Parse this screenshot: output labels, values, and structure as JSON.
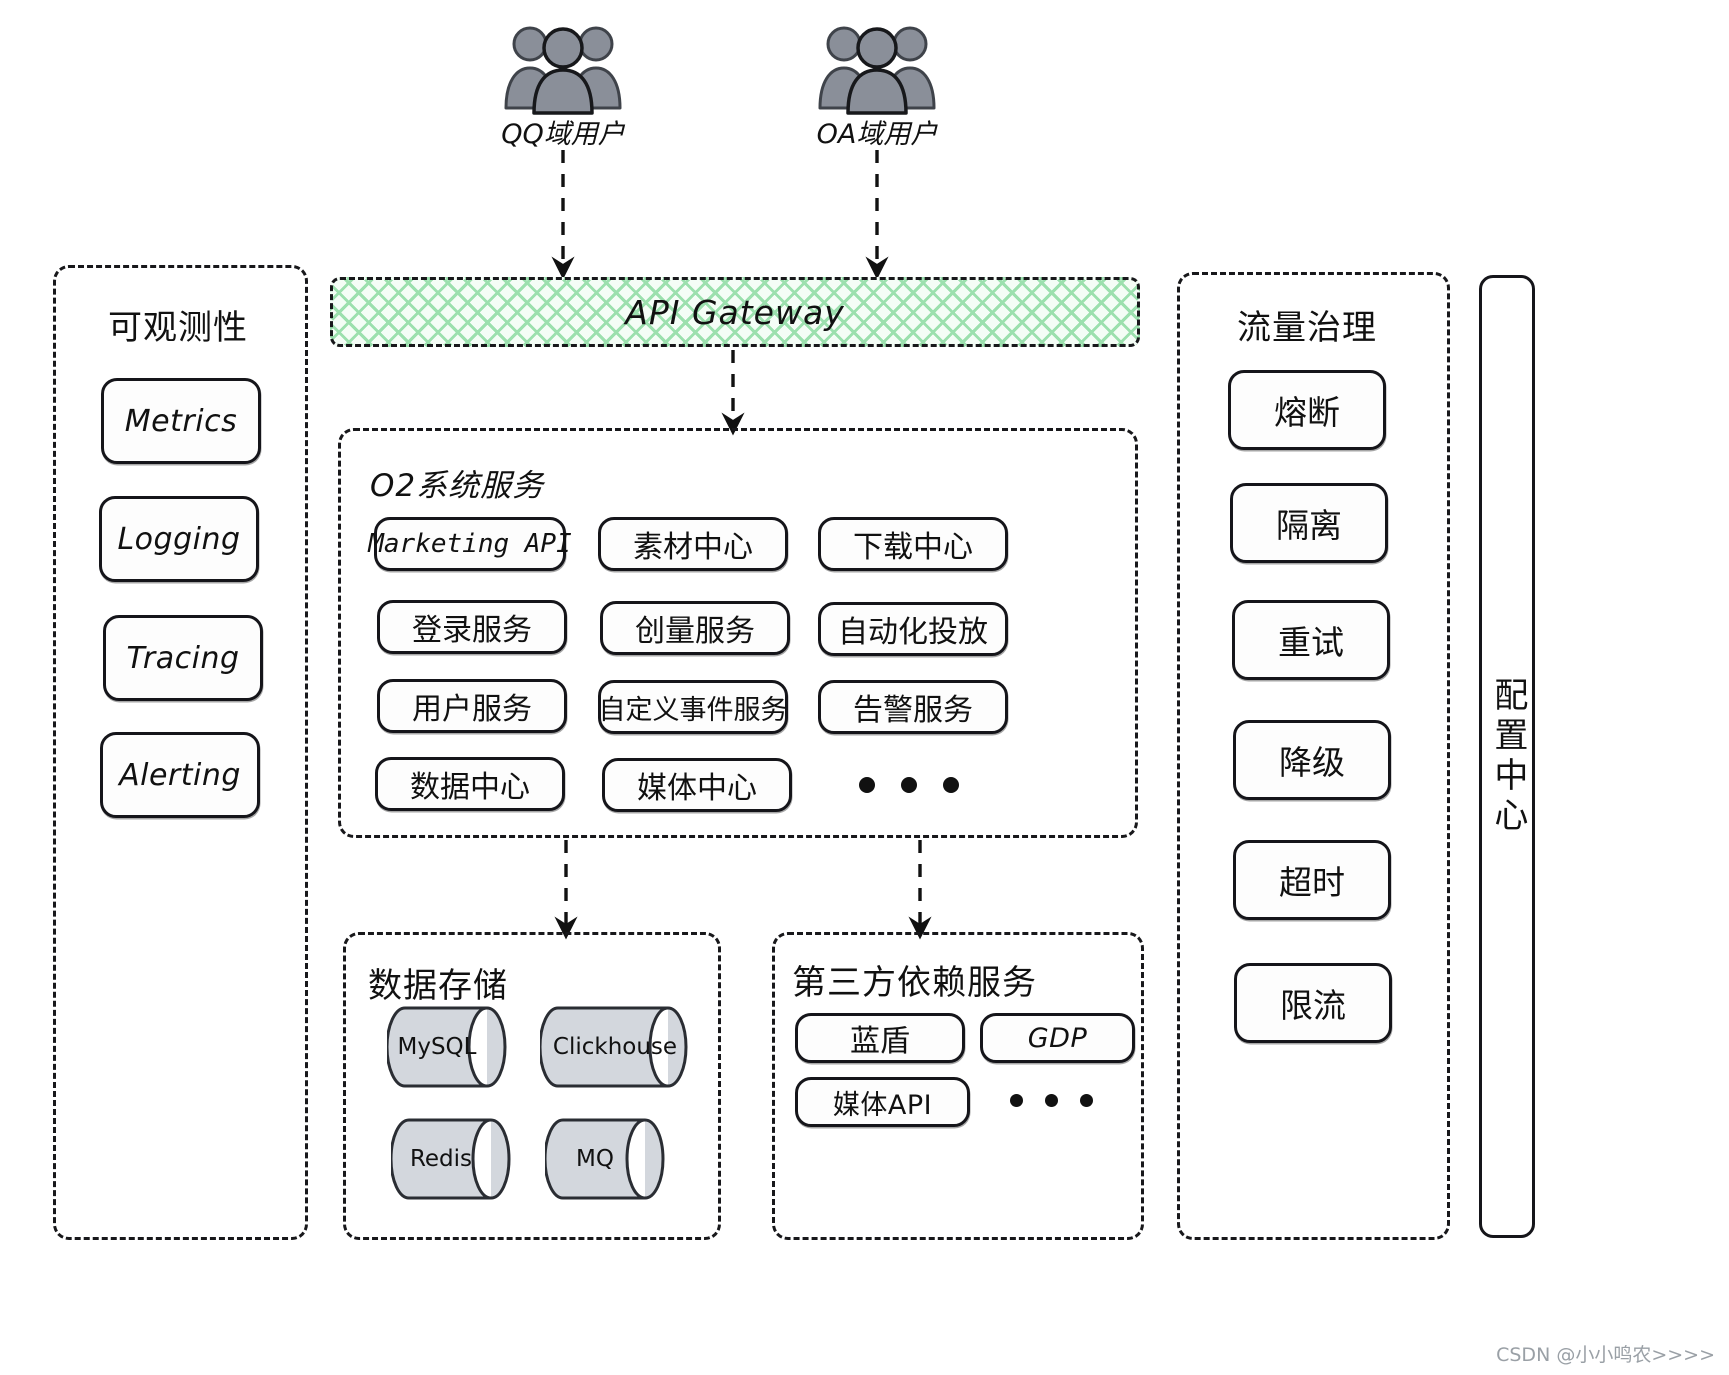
{
  "actors": [
    {
      "id": "qq",
      "label": "QQ域用户",
      "icon": "users-group-icon"
    },
    {
      "id": "oa",
      "label": "OA域用户",
      "icon": "users-group-icon"
    }
  ],
  "api_gateway": {
    "label": "API Gateway",
    "fill_color": "#9ce0ae",
    "border_color": "#18181b"
  },
  "observability": {
    "title": "可观测性",
    "items": [
      {
        "label": "Metrics"
      },
      {
        "label": "Logging"
      },
      {
        "label": "Tracing"
      },
      {
        "label": "Alerting"
      }
    ]
  },
  "o2_services": {
    "title": "O2系统服务",
    "rows": [
      [
        {
          "label": "Marketing API",
          "style": "mono"
        },
        {
          "label": "素材中心"
        },
        {
          "label": "下载中心"
        }
      ],
      [
        {
          "label": "登录服务"
        },
        {
          "label": "创量服务"
        },
        {
          "label": "自动化投放"
        }
      ],
      [
        {
          "label": "用户服务"
        },
        {
          "label": "自定义事件服务"
        },
        {
          "label": "告警服务"
        }
      ],
      [
        {
          "label": "数据中心"
        },
        {
          "label": "媒体中心"
        },
        {
          "label": "···",
          "type": "ellipsis"
        }
      ]
    ]
  },
  "data_storage": {
    "title": "数据存储",
    "items": [
      {
        "label": "MySQL"
      },
      {
        "label": "Clickhouse"
      },
      {
        "label": "Redis"
      },
      {
        "label": "MQ"
      }
    ]
  },
  "third_party": {
    "title": "第三方依赖服务",
    "items": [
      {
        "label": "蓝盾"
      },
      {
        "label": "GDP",
        "style": "en"
      },
      {
        "label": "媒体API",
        "style": "en"
      },
      {
        "label": "···",
        "type": "ellipsis"
      }
    ]
  },
  "traffic_governance": {
    "title": "流量治理",
    "items": [
      {
        "label": "熔断"
      },
      {
        "label": "隔离"
      },
      {
        "label": "重试"
      },
      {
        "label": "降级"
      },
      {
        "label": "超时"
      },
      {
        "label": "限流"
      }
    ]
  },
  "config_center": {
    "label": "配置中心"
  },
  "watermark": {
    "text": "CSDN @小小鸣农>>>>"
  }
}
